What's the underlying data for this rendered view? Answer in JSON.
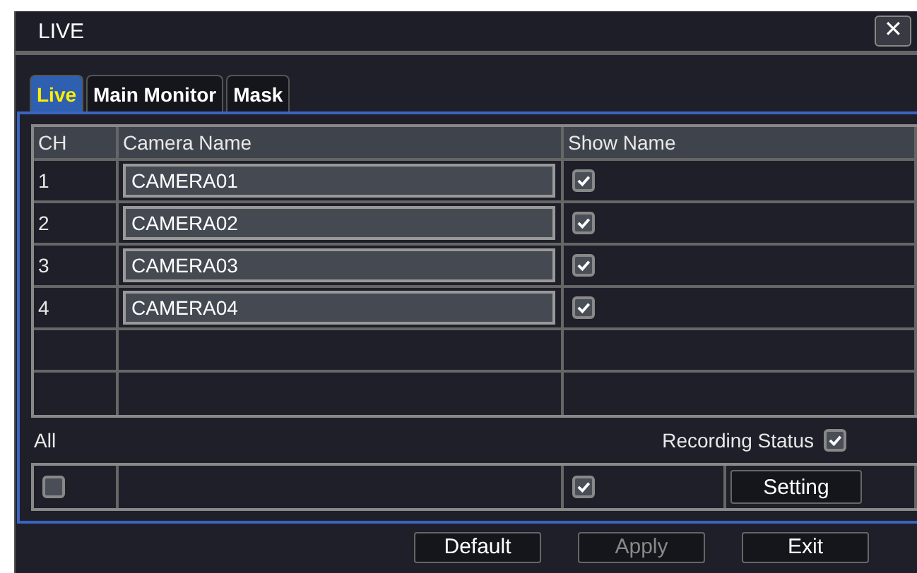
{
  "window": {
    "title": "LIVE",
    "close": "✕"
  },
  "tabs": [
    {
      "label": "Live",
      "selected": true
    },
    {
      "label": "Main Monitor",
      "selected": false
    },
    {
      "label": "Mask",
      "selected": false
    }
  ],
  "table": {
    "columns": [
      "CH",
      "Camera Name",
      "Show Name"
    ],
    "rows": [
      {
        "ch": "1",
        "name": "CAMERA01",
        "show_name": true
      },
      {
        "ch": "2",
        "name": "CAMERA02",
        "show_name": true
      },
      {
        "ch": "3",
        "name": "CAMERA03",
        "show_name": true
      },
      {
        "ch": "4",
        "name": "CAMERA04",
        "show_name": true
      }
    ]
  },
  "all": {
    "label": "All",
    "recording_status": {
      "label": "Recording Status",
      "checked": true
    },
    "select_all": false,
    "show_name": true,
    "setting": "Setting"
  },
  "buttons": [
    {
      "label": "Default",
      "disabled": false
    },
    {
      "label": "Apply",
      "disabled": true
    },
    {
      "label": "Exit",
      "disabled": false
    }
  ]
}
